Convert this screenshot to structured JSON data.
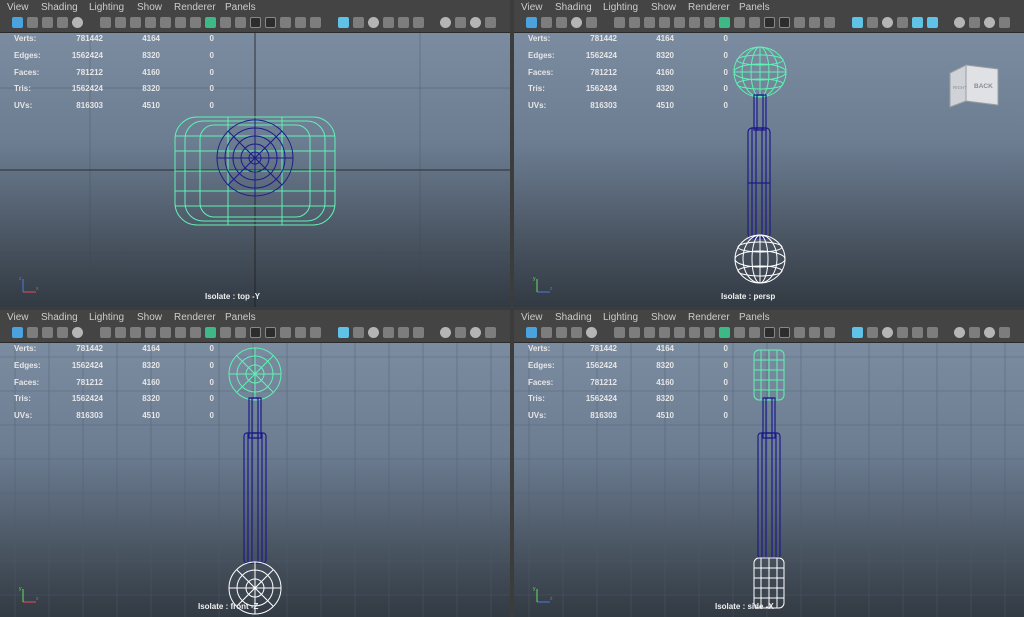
{
  "menu": [
    "View",
    "Shading",
    "Lighting",
    "Show",
    "Renderer",
    "Panels"
  ],
  "stats_rows": [
    {
      "label": "Verts:",
      "total": "781442",
      "selected": "4164",
      "extra": "0"
    },
    {
      "label": "Edges:",
      "total": "1562424",
      "selected": "8320",
      "extra": "0"
    },
    {
      "label": "Faces:",
      "total": "781212",
      "selected": "4160",
      "extra": "0"
    },
    {
      "label": "Tris:",
      "total": "1562424",
      "selected": "8320",
      "extra": "0"
    },
    {
      "label": "UVs:",
      "total": "816303",
      "selected": "4510",
      "extra": "0"
    }
  ],
  "panes": {
    "top_left": {
      "caption": "Isolate : top -Y"
    },
    "top_right": {
      "caption": "Isolate : persp"
    },
    "bottom_left": {
      "caption": "Isolate : front -Z"
    },
    "bottom_right": {
      "caption": "Isolate : side -X"
    }
  },
  "view_cube": {
    "right_face": "RIGHT",
    "back_face": "BACK"
  },
  "axis_labels": {
    "x": "x",
    "y": "y",
    "z": "z"
  },
  "colors": {
    "wire_selected": "#5ff2b4",
    "wire_object": "#1b1b8a",
    "wire_white": "#ffffff",
    "viewport_top": "#7b8ca1",
    "viewport_bottom": "#323a43",
    "panel_bg": "#444444"
  },
  "toolbar_icons": [
    "select-camera-icon",
    "camera-attributes-icon",
    "bookmark-icon",
    "image-plane-icon",
    "grid-icon",
    "film-gate-icon",
    "resolution-gate-icon",
    "safe-action-icon",
    "wireframe-icon",
    "smooth-shade-icon",
    "textured-icon",
    "lighting-icon",
    "shadows-icon",
    "xray-icon",
    "isolate-select-icon",
    "ambient-occlusion-icon"
  ]
}
